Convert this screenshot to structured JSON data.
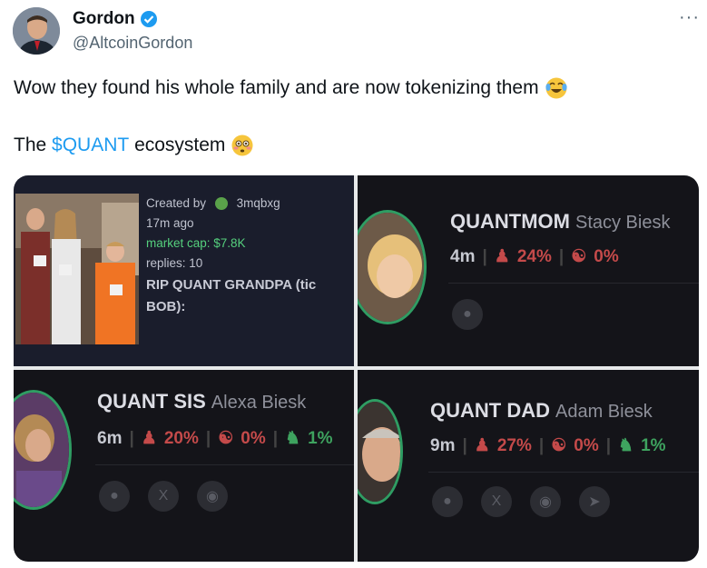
{
  "author": {
    "name": "Gordon",
    "handle": "@AltcoinGordon",
    "verified": true
  },
  "more_label": "···",
  "tweet": {
    "line1": "Wow they found his whole family and are now tokenizing them",
    "line1_emoji": "tears-of-joy-emoji",
    "line2_prefix": "The",
    "line2_link": "$QUANT",
    "line2_suffix": "ecosystem",
    "line2_emoji": "flushed-face-emoji"
  },
  "panel1": {
    "created_by": "Created by",
    "creator": "3mqbxg",
    "age": "17m ago",
    "market_cap": "market cap: $7.8K",
    "replies": "replies: 10",
    "title_line1": "RIP QUANT GRANDPA (tic",
    "title_line2": "BOB):"
  },
  "panel2": {
    "ticker": "QUANTMOM",
    "name": "Stacy Biesk",
    "age": "4m",
    "stat1": "24%",
    "stat2": "0%"
  },
  "panel3": {
    "ticker": "QUANT SIS",
    "name": "Alexa Biesk",
    "age": "6m",
    "stat1": "20%",
    "stat2": "0%",
    "stat3": "1%"
  },
  "panel4": {
    "ticker": "QUANT DAD",
    "name": "Adam Biesk",
    "age": "9m",
    "stat1": "27%",
    "stat2": "0%",
    "stat3": "1%"
  },
  "colors": {
    "link": "#1d9bf0",
    "verified": "#1d9bf0",
    "ring": "#2f9d63",
    "red_stat": "#c44a4a",
    "green_stat": "#3ea35f"
  }
}
